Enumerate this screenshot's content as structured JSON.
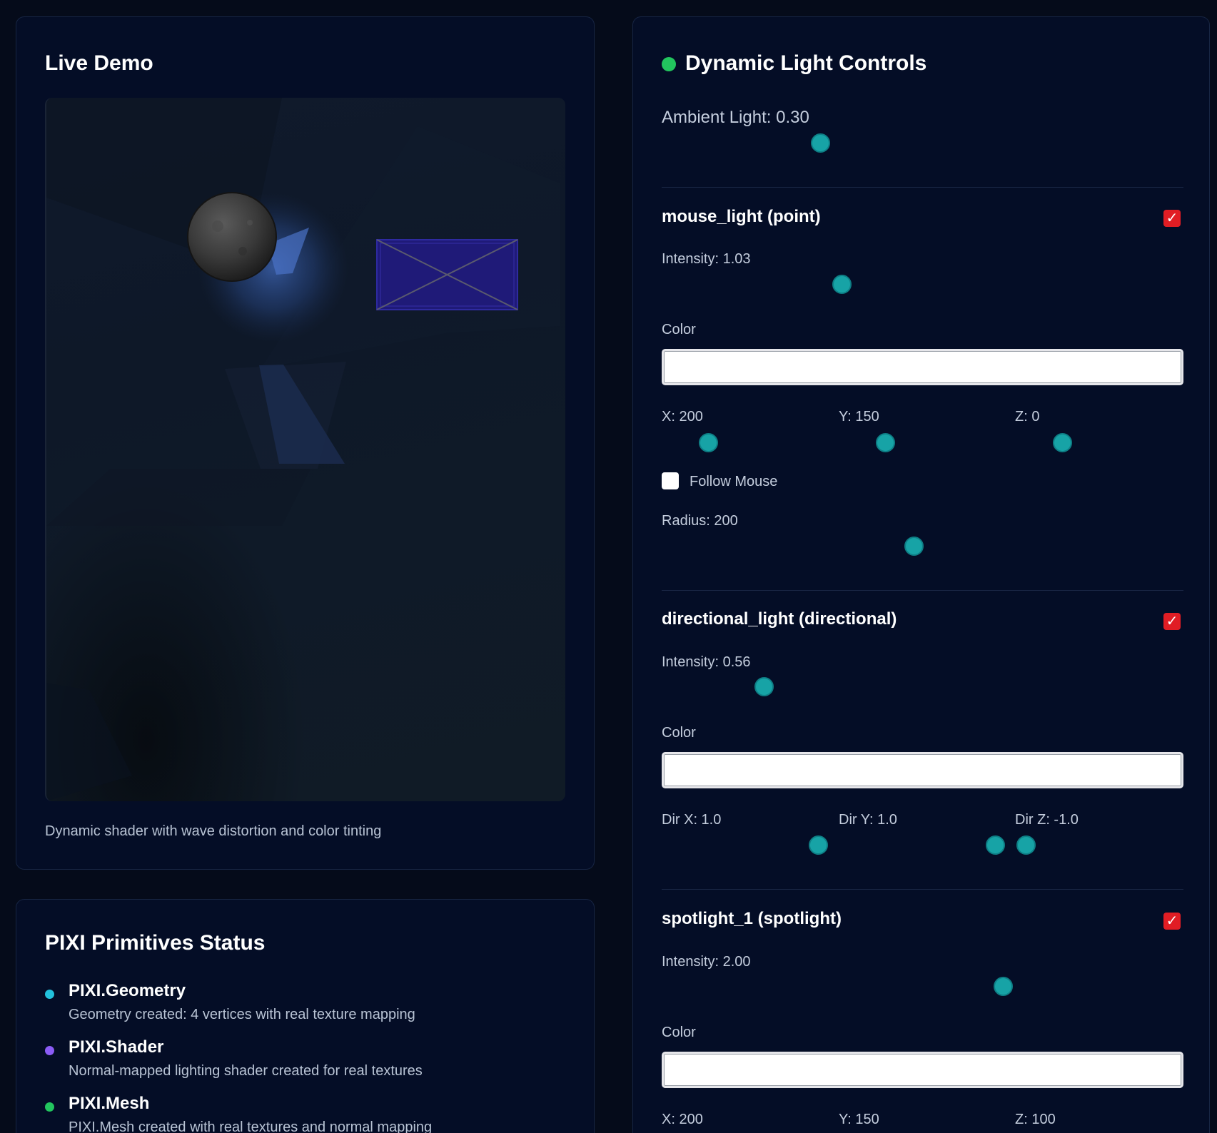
{
  "demo": {
    "title": "Live Demo",
    "caption": "Dynamic shader with wave distortion and color tinting"
  },
  "status": {
    "title": "PIXI Primitives Status",
    "items": [
      {
        "name": "PIXI.Geometry",
        "desc": "Geometry created: 4 vertices with real texture mapping",
        "color": "#22c1dc"
      },
      {
        "name": "PIXI.Shader",
        "desc": "Normal-mapped lighting shader created for real textures",
        "color": "#8b5cf6"
      },
      {
        "name": "PIXI.Mesh",
        "desc": "PIXI.Mesh created with real textures and normal mapping",
        "color": "#22c55e"
      }
    ]
  },
  "controls": {
    "title": "Dynamic Light Controls",
    "ambient_label": "Ambient Light: 0.30",
    "ambient_value": 0.3,
    "lights": [
      {
        "name": "mouse_light (point)",
        "enabled": true,
        "intensity_label": "Intensity: 1.03",
        "color_label": "Color",
        "x_label": "X: 200",
        "y_label": "Y: 150",
        "z_label": "Z: 0",
        "follow_mouse_label": "Follow Mouse",
        "follow_mouse": false,
        "radius_label": "Radius: 200"
      },
      {
        "name": "directional_light (directional)",
        "enabled": true,
        "intensity_label": "Intensity: 0.56",
        "color_label": "Color",
        "dx_label": "Dir X: 1.0",
        "dy_label": "Dir Y: 1.0",
        "dz_label": "Dir Z: -1.0"
      },
      {
        "name": "spotlight_1 (spotlight)",
        "enabled": true,
        "intensity_label": "Intensity: 2.00",
        "color_label": "Color",
        "x_label": "X: 200",
        "y_label": "Y: 150",
        "z_label": "Z: 100"
      }
    ],
    "checkmark": "✓"
  }
}
